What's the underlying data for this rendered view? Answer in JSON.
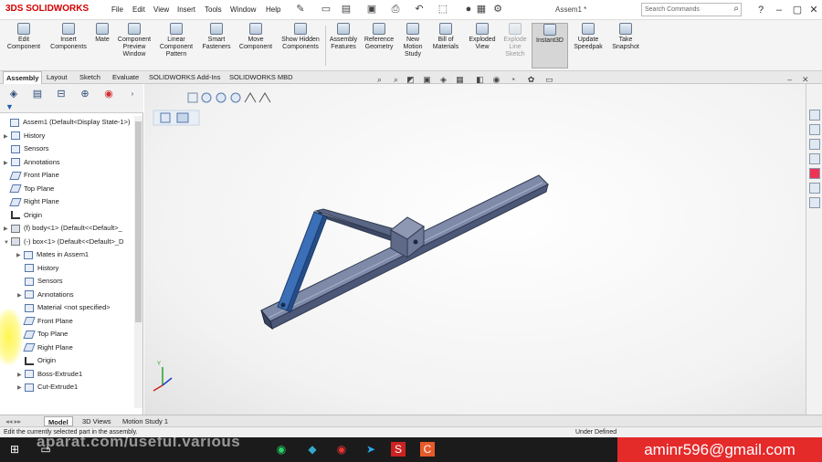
{
  "app": {
    "logo_mark": "3DS",
    "logo_text": "SOLIDWORKS",
    "doc_title": "Assem1 *"
  },
  "menu": [
    "File",
    "Edit",
    "View",
    "Insert",
    "Tools",
    "Window",
    "Help"
  ],
  "search": {
    "placeholder": "Search Commands"
  },
  "commands": [
    {
      "label": "Edit Component"
    },
    {
      "label": "Insert Components"
    },
    {
      "label": "Mate"
    },
    {
      "label": "Component Preview Window"
    },
    {
      "label": "Linear Component Pattern"
    },
    {
      "label": "Smart Fasteners"
    },
    {
      "label": "Move Component"
    },
    {
      "label": "Show Hidden Components"
    },
    {
      "label": "Assembly Features"
    },
    {
      "label": "Reference Geometry"
    },
    {
      "label": "New Motion Study"
    },
    {
      "label": "Bill of Materials"
    },
    {
      "label": "Exploded View"
    },
    {
      "label": "Explode Line Sketch"
    },
    {
      "label": "Instant3D"
    },
    {
      "label": "Update Speedpak"
    },
    {
      "label": "Take Snapshot"
    }
  ],
  "tabs": [
    "Assembly",
    "Layout",
    "Sketch",
    "Evaluate",
    "SOLIDWORKS Add-Ins",
    "SOLIDWORKS MBD"
  ],
  "tree": [
    {
      "label": "Assem1  (Default<Display State-1>)",
      "icon": "assembly-icon"
    },
    {
      "label": "History",
      "icon": "history-icon"
    },
    {
      "label": "Sensors",
      "icon": "sensors-icon"
    },
    {
      "label": "Annotations",
      "icon": "annotations-icon"
    },
    {
      "label": "Front Plane",
      "icon": "plane-icon"
    },
    {
      "label": "Top Plane",
      "icon": "plane-icon"
    },
    {
      "label": "Right Plane",
      "icon": "plane-icon"
    },
    {
      "label": "Origin",
      "icon": "origin-icon"
    },
    {
      "label": "(f) body<1> (Default<<Default>_",
      "icon": "part-icon"
    },
    {
      "label": "(-) box<1> (Default<<Default>_D",
      "icon": "part-icon"
    },
    {
      "label": "Mates in Assem1",
      "icon": "mates-icon"
    },
    {
      "label": "History",
      "icon": "history-icon"
    },
    {
      "label": "Sensors",
      "icon": "sensors-icon"
    },
    {
      "label": "Annotations",
      "icon": "annotations-icon"
    },
    {
      "label": "Material <not specified>",
      "icon": "material-icon"
    },
    {
      "label": "Front Plane",
      "icon": "plane-icon"
    },
    {
      "label": "Top Plane",
      "icon": "plane-icon"
    },
    {
      "label": "Right Plane",
      "icon": "plane-icon"
    },
    {
      "label": "Origin",
      "icon": "origin-icon"
    },
    {
      "label": "Boss-Extrude1",
      "icon": "extrude-icon"
    },
    {
      "label": "Cut-Extrude1",
      "icon": "cut-extrude-icon"
    }
  ],
  "bottom_tabs": [
    "Model",
    "3D Views",
    "Motion Study 1"
  ],
  "status": {
    "left": "Edit the currently selected part in the assembly.",
    "right": "Under Defined"
  },
  "overlay": {
    "watermark": "aparat.com/useful.various",
    "email": "aminr596@gmail.com"
  },
  "colors": {
    "accent": "#d40000",
    "email_bg": "#e52a2a",
    "link_color": "#2e5fa8",
    "rail_color": "#5d6b8a"
  }
}
